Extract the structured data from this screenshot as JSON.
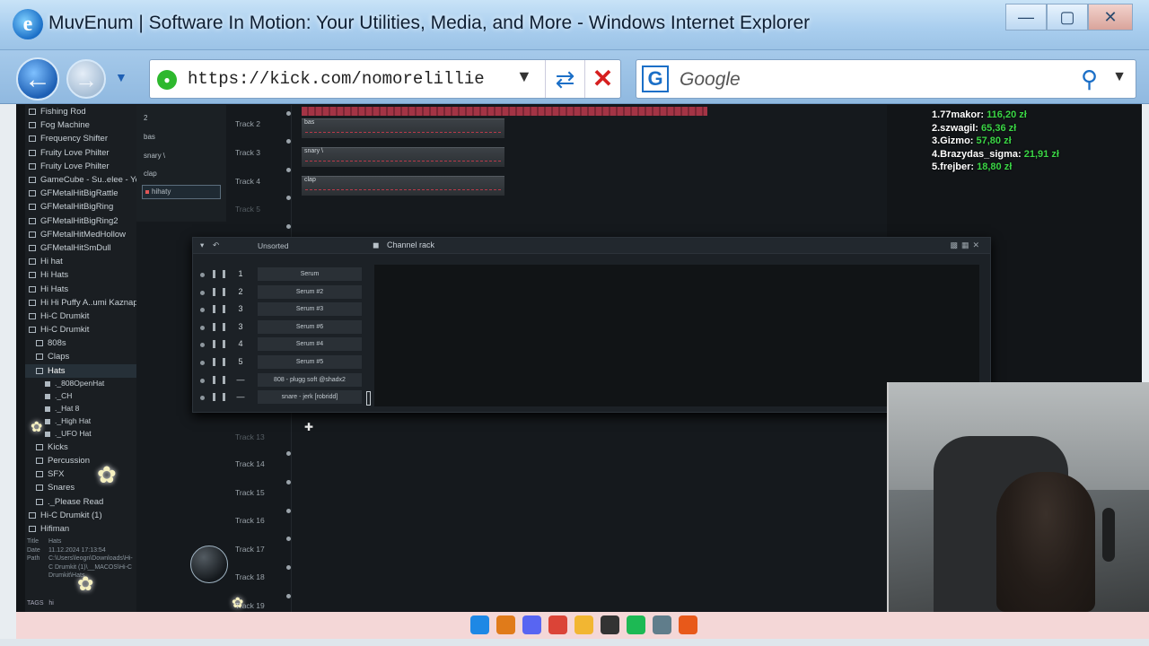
{
  "window": {
    "title": "MuvEnum | Software In Motion: Your Utilities, Media, and More - Windows Internet Explorer",
    "controls": {
      "minimize": "—",
      "maximize": "▢",
      "close": "✕"
    }
  },
  "navbar": {
    "address": "https://kick.com/nomorelillie",
    "search_placeholder": "Google"
  },
  "browser": {
    "items": [
      {
        "label": "Fishing Rod",
        "level": 0
      },
      {
        "label": "Fog Machine",
        "level": 0
      },
      {
        "label": "Frequency Shifter",
        "level": 0
      },
      {
        "label": "Fruity Love Philter",
        "level": 0
      },
      {
        "label": "Fruity Love Philter",
        "level": 0
      },
      {
        "label": "GameCube - Su..elee - Yoshi",
        "level": 0
      },
      {
        "label": "GFMetalHitBigRattle",
        "level": 0
      },
      {
        "label": "GFMetalHitBigRing",
        "level": 0
      },
      {
        "label": "GFMetalHitBigRing2",
        "level": 0
      },
      {
        "label": "GFMetalHitMedHollow",
        "level": 0
      },
      {
        "label": "GFMetalHitSmDull",
        "level": 0
      },
      {
        "label": "Hi hat",
        "level": 0
      },
      {
        "label": "Hi Hats",
        "level": 0
      },
      {
        "label": "Hi Hats",
        "level": 0
      },
      {
        "label": "Hi Hi Puffy A..umi Kaznapped",
        "level": 0
      },
      {
        "label": "Hi-C Drumkit",
        "level": 0
      },
      {
        "label": "Hi-C Drumkit",
        "level": 0
      },
      {
        "label": "808s",
        "level": 1
      },
      {
        "label": "Claps",
        "level": 1
      },
      {
        "label": "Hats",
        "level": 1
      },
      {
        "label": "._808OpenHat",
        "level": 2
      },
      {
        "label": "._CH",
        "level": 2
      },
      {
        "label": "._Hat 8",
        "level": 2
      },
      {
        "label": "._High Hat",
        "level": 2
      },
      {
        "label": "._UFO Hat",
        "level": 2
      },
      {
        "label": "Kicks",
        "level": 1
      },
      {
        "label": "Percussion",
        "level": 1
      },
      {
        "label": "SFX",
        "level": 1
      },
      {
        "label": "Snares",
        "level": 1
      },
      {
        "label": "._Please Read",
        "level": 1
      },
      {
        "label": "Hi-C Drumkit (1)",
        "level": 0
      },
      {
        "label": "Hifiman",
        "level": 0
      }
    ],
    "info": {
      "title_key": "Title",
      "title_val": "Hats",
      "date_key": "Date",
      "date_val": "11.12.2024 17:13:54",
      "path_key": "Path",
      "path_val": "C:\\Users\\leogn\\Downloads\\Hi-C Drumkit (1)\\__MACOS\\Hi-C Drumkit\\Hats"
    },
    "tags_label": "TAGS",
    "tags_value": "hi"
  },
  "playlist": {
    "patterns": [
      "2",
      "bas",
      "snary \\",
      "clap",
      "hihaty"
    ],
    "tracks": [
      "Track 2",
      "Track 3",
      "Track 4",
      "Track 5",
      "Track 13",
      "Track 14",
      "Track 15",
      "Track 16",
      "Track 17",
      "Track 18",
      "Track 19"
    ],
    "clips": [
      "bas",
      "snary \\",
      "clap"
    ]
  },
  "channel_rack": {
    "sort": "Unsorted",
    "title": "Channel rack",
    "channels": [
      {
        "num": "1",
        "name": "Serum"
      },
      {
        "num": "2",
        "name": "Serum #2"
      },
      {
        "num": "3",
        "name": "Serum #3"
      },
      {
        "num": "3",
        "name": "Serum #6"
      },
      {
        "num": "4",
        "name": "Serum #4"
      },
      {
        "num": "5",
        "name": "Serum #5"
      },
      {
        "num": "—",
        "name": "808 - plugg soft @shadx2"
      },
      {
        "num": "—",
        "name": "snare - jerk [robridd]"
      }
    ]
  },
  "donations": [
    {
      "name": "1.77makor:",
      "amount": "116,20 zł"
    },
    {
      "name": "2.szwagil:",
      "amount": "65,36 zł"
    },
    {
      "name": "3.Gizmo:",
      "amount": "57,80 zł"
    },
    {
      "name": "4.Brazydas_sigma:",
      "amount": "21,91 zł"
    },
    {
      "name": "5.frejber:",
      "amount": "18,80 zł"
    }
  ],
  "taskbar": {
    "icons": [
      "windows-start-icon",
      "browser-icon",
      "discord-icon",
      "chrome-icon",
      "file-explorer-icon",
      "obs-icon",
      "spotify-icon",
      "calculator-icon",
      "fl-studio-icon"
    ],
    "colors": [
      "#1e88e5",
      "#e07b1a",
      "#5865f2",
      "#db4437",
      "#f2b632",
      "#333333",
      "#1db954",
      "#607d8b",
      "#e8591a"
    ]
  }
}
